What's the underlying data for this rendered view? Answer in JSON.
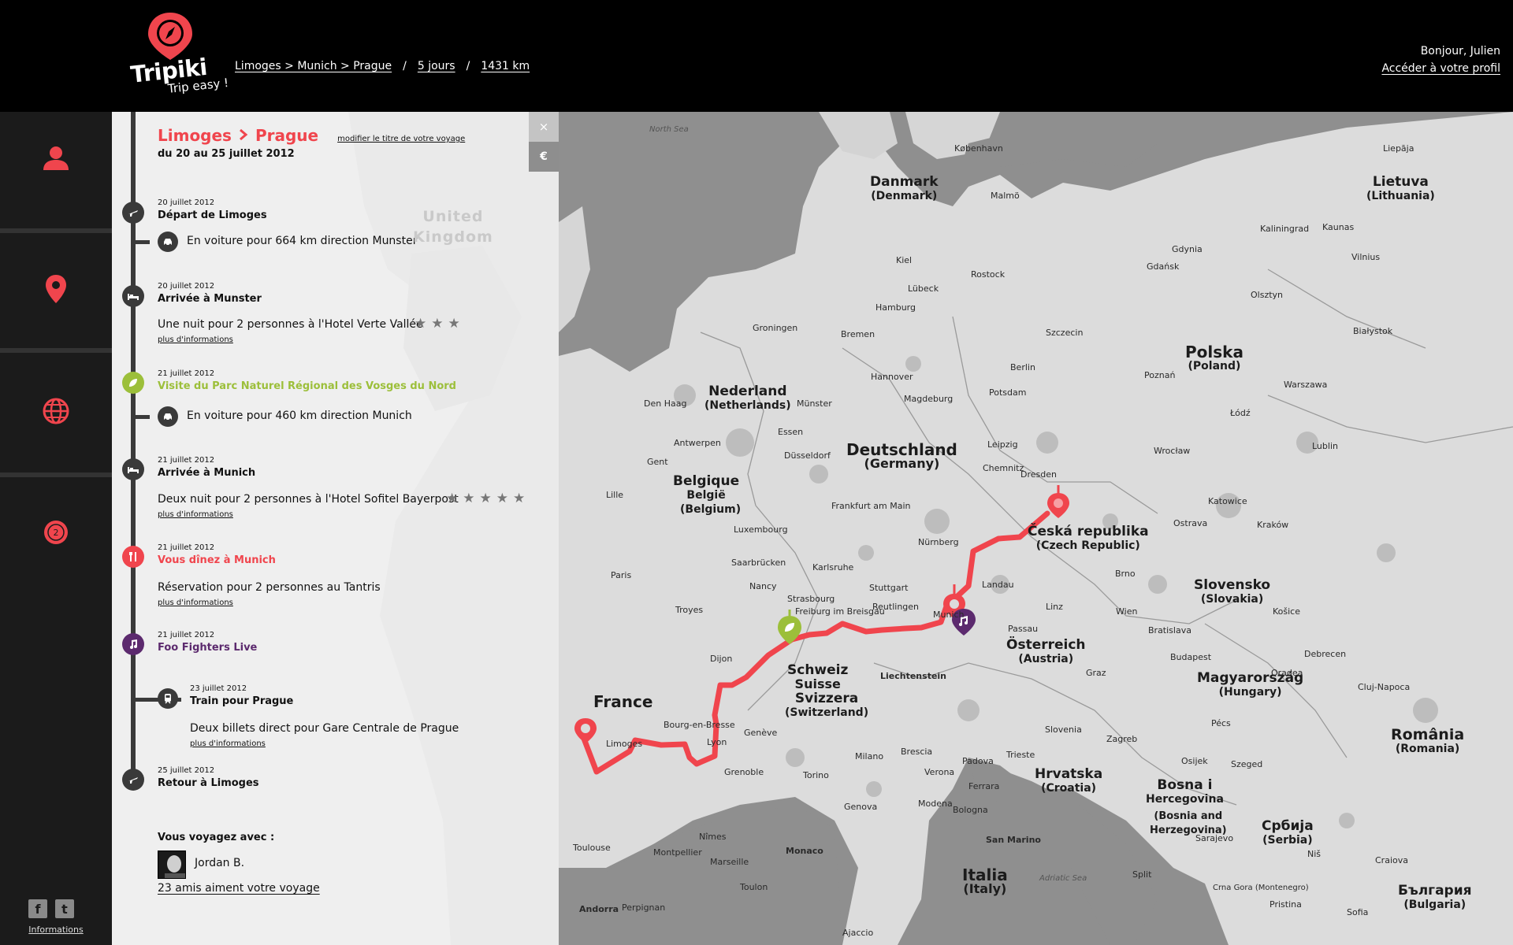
{
  "header": {
    "brand": "Tripiki",
    "tagline": "Trip easy !",
    "route_link": "Limoges > Munich > Prague",
    "sep1": "/",
    "duration_link": "5 jours",
    "sep2": "/",
    "distance_link": "1431 km",
    "greeting": "Bonjour, Julien",
    "profile_link": "Accéder à votre profil"
  },
  "nav": {
    "items": [
      {
        "icon": "user-icon"
      },
      {
        "icon": "map-pin-icon"
      },
      {
        "icon": "globe-icon"
      },
      {
        "icon": "notification-icon",
        "badge": "2"
      }
    ],
    "footer_link": "Informations"
  },
  "trip": {
    "origin": "Limoges",
    "destination": "Prague",
    "edit_link": "modifier le titre de votre voyage",
    "date_range": "du 20 au 25 juillet 2012",
    "close_label": "×",
    "currency_label": "€",
    "events": [
      {
        "date": "20 juillet 2012",
        "title": "Départ de Limoges",
        "icon": "plane-icon"
      },
      {
        "desc": "En voiture pour 664 km direction Munster",
        "icon": "car-icon"
      },
      {
        "date": "20 juillet 2012",
        "title": "Arrivée à Munster",
        "desc": "Une nuit pour 2 personnes à l'Hotel Verte Vallée",
        "more": "plus d'informations",
        "stars": 3,
        "icon": "bed-icon"
      },
      {
        "date": "21 juillet 2012",
        "title": "Visite du Parc Naturel Régional des Vosges du Nord",
        "icon": "leaf-icon"
      },
      {
        "desc": "En voiture pour 460 km direction Munich",
        "icon": "car-icon"
      },
      {
        "date": "21 juillet 2012",
        "title": "Arrivée à Munich",
        "desc": "Deux nuit pour 2 personnes à l'Hotel Sofitel Bayerpost",
        "more": "plus d'informations",
        "stars": 5,
        "icon": "bed-icon"
      },
      {
        "date": "21 juillet 2012",
        "title": "Vous dînez à Munich",
        "desc": "Réservation pour 2 personnes au Tantris",
        "more": "plus d'informations",
        "icon": "cutlery-icon"
      },
      {
        "date": "21 juillet 2012",
        "title": "Foo Fighters Live",
        "icon": "music-icon"
      },
      {
        "date": "23 juillet 2012",
        "title": "Train pour Prague",
        "desc": "Deux billets direct pour Gare Centrale de Prague",
        "more": "plus d'informations",
        "icon": "train-icon"
      },
      {
        "date": "25 juillet 2012",
        "title": "Retour à Limoges",
        "icon": "plane-icon"
      }
    ],
    "companions_title": "Vous voyagez avec :",
    "companion_name": "Jordan B.",
    "likes_link": "23 amis aiment votre voyage"
  },
  "colors": {
    "accent": "#f0454d",
    "green": "#9cbf3a",
    "purple": "#5c2a6e",
    "timeline": "#3a3a3a"
  },
  "map": {
    "countries": [
      {
        "name": "Danmark",
        "sub": "(Denmark)"
      },
      {
        "name": "Lietuva",
        "sub": "(Lithuania)"
      },
      {
        "name": "Polska",
        "sub": "(Poland)"
      },
      {
        "name": "Nederland",
        "sub": "(Netherlands)"
      },
      {
        "name": "Deutschland",
        "sub": "(Germany)"
      },
      {
        "name": "Belgique",
        "sub": "België"
      },
      {
        "name": "(Belgium)",
        "sub": ""
      },
      {
        "name": "Česká republika",
        "sub": "(Czech Republic)"
      },
      {
        "name": "Slovensko",
        "sub": "(Slovakia)"
      },
      {
        "name": "France",
        "sub": ""
      },
      {
        "name": "Schweiz",
        "sub": "Suisse"
      },
      {
        "name": "Svizzera",
        "sub": "(Switzerland)"
      },
      {
        "name": "Österreich",
        "sub": "(Austria)"
      },
      {
        "name": "Magyarország",
        "sub": "(Hungary)"
      },
      {
        "name": "România",
        "sub": "(Romania)"
      },
      {
        "name": "Hrvatska",
        "sub": "(Croatia)"
      },
      {
        "name": "Bosna i",
        "sub": "Hercegovina"
      },
      {
        "name": "(Bosnia and",
        "sub": "Herzegovina)"
      },
      {
        "name": "Србија",
        "sub": "(Serbia)"
      },
      {
        "name": "Italia",
        "sub": "(Italy)"
      },
      {
        "name": "България",
        "sub": "(Bulgaria)"
      },
      {
        "name": "United",
        "sub": "Kingdom"
      }
    ],
    "cities": [
      "North Sea",
      "Liepāja",
      "København",
      "Malmö",
      "Kiel",
      "Rostock",
      "Gdynia",
      "Gdańsk",
      "Kaliningrad",
      "Kaunas",
      "Vilnius",
      "Lübeck",
      "Hamburg",
      "Szczecin",
      "Olsztyn",
      "Białystok",
      "Bremen",
      "Groningen",
      "Hannover",
      "Berlin",
      "Poznań",
      "Warszawa",
      "Den Haag",
      "Münster",
      "Magdeburg",
      "Potsdam",
      "Łódź",
      "Antwerpen",
      "Essen",
      "Leipzig",
      "Wrocław",
      "Lublin",
      "Gent",
      "Düsseldorf",
      "Dresden",
      "Chemnitz",
      "Katowice",
      "Lille",
      "Frankfurt am Main",
      "Kraków",
      "Luxembourg",
      "Nürnberg",
      "Ostrava",
      "Paris",
      "Saarbrücken",
      "Karlsruhe",
      "Brno",
      "Nancy",
      "Stuttgart",
      "Strasbourg",
      "Landau",
      "Passau",
      "Linz",
      "Wien",
      "Bratislava",
      "Košice",
      "Troyes",
      "Freiburg im Breisgau",
      "Reutlingen",
      "Munich",
      "Budapest",
      "Debrecen",
      "Dijon",
      "Liechtenstein",
      "Graz",
      "Oradea",
      "Cluj-Napoca",
      "Bourg-en-Bresse",
      "Lyon",
      "Genève",
      "Slovenia",
      "Zagreb",
      "Pécs",
      "Szeged",
      "Limoges",
      "Grenoble",
      "Milano",
      "Brescia",
      "Verona",
      "Padova",
      "Trieste",
      "Torino",
      "Modena",
      "Ferrara",
      "Genova",
      "Bologna",
      "Osijek",
      "Toulouse",
      "Montpellier",
      "Nîmes",
      "Marseille",
      "Monaco",
      "San Marino",
      "Split",
      "Sarajevo",
      "Niš",
      "Craiova",
      "Perpignan",
      "Toulon",
      "Andorra",
      "Adriatic Sea",
      "Ajaccio",
      "Sofia",
      "Pristina",
      "Crna Gora (Montenegro)"
    ]
  }
}
